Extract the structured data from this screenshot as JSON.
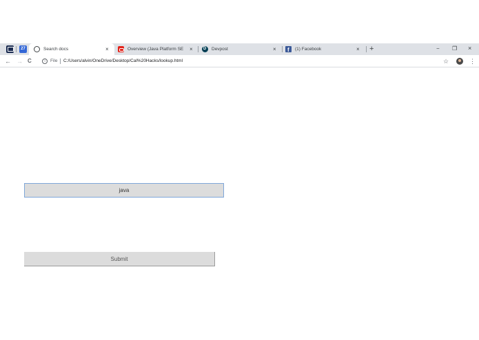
{
  "browser": {
    "tabs": [
      {
        "title": "Search docs",
        "icon": "chrome-icon",
        "active": true
      },
      {
        "title": "Overview (Java Platform SE 8 )",
        "icon": "oracle-icon",
        "active": false
      },
      {
        "title": "Devpost",
        "icon": "devpost-icon",
        "active": false
      },
      {
        "title": "(1) Facebook",
        "icon": "facebook-icon",
        "active": false
      }
    ],
    "pinned_tabs": [
      "pinned-app-icon",
      "calendar-icon"
    ],
    "pinned_calendar_text": "27",
    "close_glyph": "×",
    "new_tab_glyph": "+",
    "window_controls": {
      "minimize": "−",
      "restore": "❐",
      "close": "×"
    },
    "nav": {
      "back": "←",
      "forward": "→",
      "reload": "C"
    },
    "address": {
      "info_glyph": "i",
      "scheme_label": "File",
      "url": "C:/Users/alvin/OneDrive/Desktop/Cal%20Hacks/lookup.html"
    },
    "bookmark_glyph": "☆",
    "menu_glyph": "⋮"
  },
  "page": {
    "search_value": "java",
    "submit_label": "Submit"
  },
  "colors": {
    "tabstrip": "#dee1e6",
    "input_border": "#7ea6d9",
    "field_background": "#dcdcdc"
  }
}
